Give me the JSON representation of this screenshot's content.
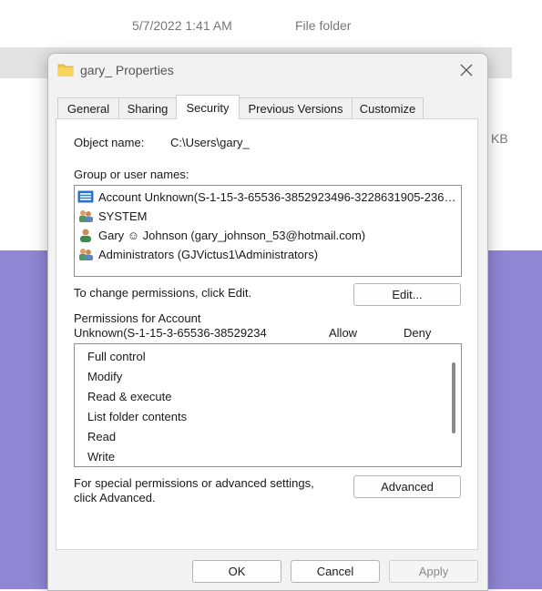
{
  "background": {
    "date_modified": "5/7/2022 1:41 AM",
    "type": "File folder",
    "size_unit": "KB"
  },
  "dialog": {
    "title": "gary_ Properties",
    "close_icon": "close-icon",
    "tabs": [
      {
        "label": "General"
      },
      {
        "label": "Sharing"
      },
      {
        "label": "Security",
        "active": true
      },
      {
        "label": "Previous Versions"
      },
      {
        "label": "Customize"
      }
    ],
    "object_name_label": "Object name:",
    "object_name_value": "C:\\Users\\gary_",
    "group_label": "Group or user names:",
    "users": [
      {
        "name": "Account Unknown(S-1-15-3-65536-3852923496-3228631905-23617...",
        "icon": "unknown-account-icon"
      },
      {
        "name": "SYSTEM",
        "icon": "group-icon"
      },
      {
        "name": "Gary ☺ Johnson (gary_johnson_53@hotmail.com)",
        "icon": "user-icon"
      },
      {
        "name": "Administrators (GJVictus1\\Administrators)",
        "icon": "group-icon"
      }
    ],
    "change_hint": "To change permissions, click Edit.",
    "edit_button": "Edit...",
    "permissions_for_line1": "Permissions for Account",
    "permissions_for_line2": "Unknown(S-1-15-3-65536-38529234…",
    "allow_header": "Allow",
    "deny_header": "Deny",
    "permissions": [
      {
        "name": "Full control"
      },
      {
        "name": "Modify"
      },
      {
        "name": "Read & execute"
      },
      {
        "name": "List folder contents"
      },
      {
        "name": "Read"
      },
      {
        "name": "Write"
      }
    ],
    "special_hint_line1": "For special permissions or advanced settings,",
    "special_hint_line2": "click Advanced.",
    "advanced_button": "Advanced",
    "ok_button": "OK",
    "cancel_button": "Cancel",
    "apply_button": "Apply"
  },
  "colors": {
    "wallpaper": "#8f86d4",
    "dialog_bg": "#f2f2f2",
    "folder_yellow": "#f3c53c"
  }
}
